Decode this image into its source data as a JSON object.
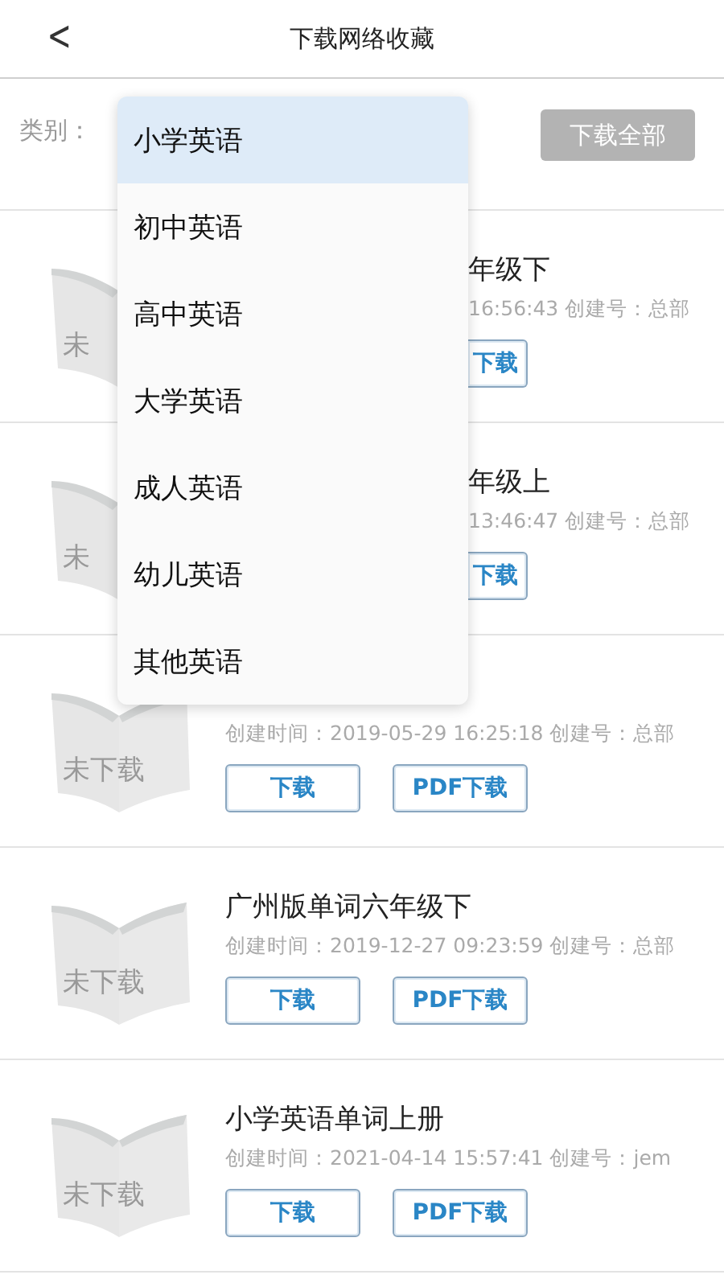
{
  "header": {
    "back": "<",
    "title": "下载网络收藏"
  },
  "filter": {
    "label": "类别：",
    "download_all": "下载全部"
  },
  "menu": [
    {
      "label": "小学英语",
      "selected": true
    },
    {
      "label": "初中英语",
      "selected": false
    },
    {
      "label": "高中英语",
      "selected": false
    },
    {
      "label": "大学英语",
      "selected": false
    },
    {
      "label": "成人英语",
      "selected": false
    },
    {
      "label": "幼儿英语",
      "selected": false
    },
    {
      "label": "其他英语",
      "selected": false
    }
  ],
  "rows": [
    {
      "kind": "partial",
      "cover": "未",
      "title": "年级下",
      "meta": "16:56:43 创建号：总部",
      "buttons": [
        "下载"
      ]
    },
    {
      "kind": "partial",
      "cover": "未",
      "title": "年级上",
      "meta": "13:46:47 创建号：总部",
      "buttons": [
        "下载"
      ]
    },
    {
      "kind": "full",
      "cover": "未下载",
      "meta": "创建时间：2019-05-29 16:25:18 创建号：总部",
      "buttons": [
        "下载",
        "PDF下载"
      ]
    },
    {
      "kind": "full",
      "cover": "未下载",
      "title": "广州版单词六年级下",
      "meta": "创建时间：2019-12-27 09:23:59 创建号：总部",
      "buttons": [
        "下载",
        "PDF下载"
      ]
    },
    {
      "kind": "full",
      "cover": "未下载",
      "title": "小学英语单词上册",
      "meta": "创建时间：2021-04-14 15:57:41 创建号：jem",
      "buttons": [
        "下载",
        "PDF下载"
      ]
    }
  ]
}
